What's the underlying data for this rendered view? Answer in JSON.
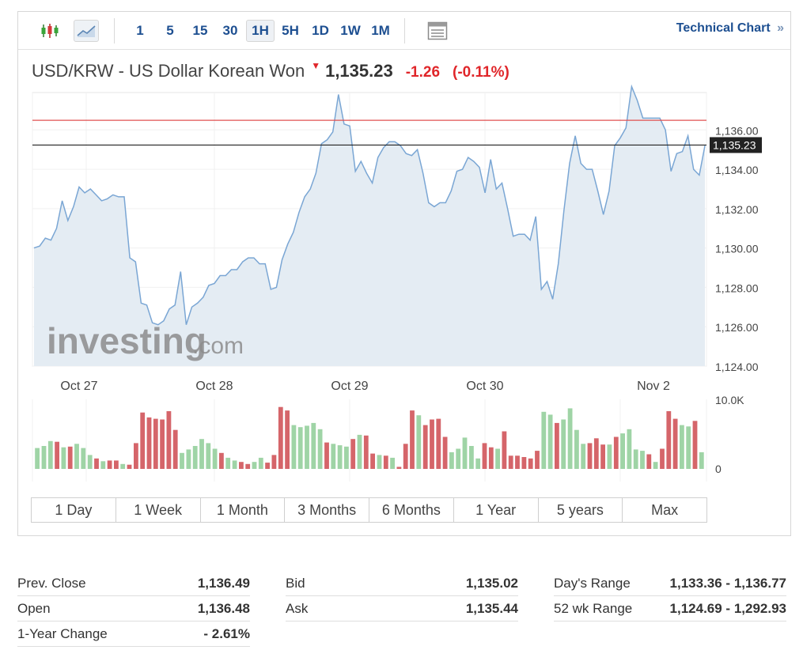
{
  "toolbar": {
    "icons": [
      "candlestick-icon",
      "area-chart-icon",
      "table-icon"
    ],
    "intervals": [
      "1",
      "5",
      "15",
      "30",
      "1H",
      "5H",
      "1D",
      "1W",
      "1M"
    ],
    "active_interval": "1H",
    "tech_link": "Technical Chart",
    "tech_link_arrow": "»"
  },
  "header": {
    "pair_name": "USD/KRW - US Dollar Korean Won",
    "direction_arrow": "▼",
    "last": "1,135.23",
    "change": "-1.26",
    "change_pct": "(-0.11%)"
  },
  "watermark": {
    "brand": "investing",
    "suffix": ".com"
  },
  "chart_data": {
    "type": "area",
    "x_tick_labels": [
      "Oct 27",
      "Oct 28",
      "Oct 29",
      "Oct 30",
      "Nov 2"
    ],
    "y_tick_labels": [
      "1,124.00",
      "1,126.00",
      "1,128.00",
      "1,130.00",
      "1,132.00",
      "1,134.00",
      "1,136.00"
    ],
    "ylim": [
      1124,
      1137.9
    ],
    "current_price": 1135.23,
    "current_price_label": "1,135.23",
    "prev_close_line": 1136.49,
    "price_series": [
      1130.0,
      1130.1,
      1130.5,
      1130.4,
      1131.0,
      1132.4,
      1131.4,
      1132.1,
      1133.1,
      1132.8,
      1133.0,
      1132.7,
      1132.4,
      1132.5,
      1132.7,
      1132.6,
      1132.6,
      1129.5,
      1129.3,
      1127.2,
      1127.1,
      1126.2,
      1126.1,
      1126.3,
      1126.9,
      1127.1,
      1128.8,
      1126.1,
      1127.0,
      1127.2,
      1127.5,
      1128.1,
      1128.2,
      1128.6,
      1128.6,
      1128.9,
      1128.9,
      1129.3,
      1129.5,
      1129.5,
      1129.2,
      1129.2,
      1127.9,
      1128.0,
      1129.4,
      1130.2,
      1130.8,
      1131.8,
      1132.6,
      1133.0,
      1133.8,
      1135.3,
      1135.5,
      1135.9,
      1137.8,
      1136.3,
      1136.2,
      1133.9,
      1134.4,
      1133.8,
      1133.3,
      1134.6,
      1135.1,
      1135.4,
      1135.4,
      1135.2,
      1134.8,
      1134.7,
      1135.0,
      1133.8,
      1132.3,
      1132.1,
      1132.3,
      1132.3,
      1132.9,
      1133.9,
      1134.0,
      1134.6,
      1134.4,
      1134.1,
      1132.8,
      1134.5,
      1133.0,
      1133.3,
      1132.0,
      1130.6,
      1130.7,
      1130.7,
      1130.4,
      1131.6,
      1127.9,
      1128.3,
      1127.4,
      1129.2,
      1131.9,
      1134.3,
      1135.7,
      1134.3,
      1134.0,
      1134.0,
      1132.9,
      1131.7,
      1132.9,
      1135.2,
      1135.6,
      1136.1,
      1138.2,
      1137.5,
      1136.6,
      1136.6,
      1136.6,
      1136.6,
      1136.0,
      1133.9,
      1134.8,
      1134.9,
      1135.7,
      1134.0,
      1133.7,
      1135.2
    ],
    "volume_axis_labels": [
      "10.0K",
      "0"
    ],
    "volume_max": 10000,
    "volume_bars": [
      {
        "v": 3000,
        "up": 1
      },
      {
        "v": 3300,
        "up": 1
      },
      {
        "v": 4000,
        "up": 1
      },
      {
        "v": 3900,
        "up": 0
      },
      {
        "v": 3100,
        "up": 1
      },
      {
        "v": 3200,
        "up": 0
      },
      {
        "v": 3600,
        "up": 1
      },
      {
        "v": 3000,
        "up": 1
      },
      {
        "v": 2000,
        "up": 1
      },
      {
        "v": 1500,
        "up": 0
      },
      {
        "v": 1100,
        "up": 1
      },
      {
        "v": 1200,
        "up": 0
      },
      {
        "v": 1200,
        "up": 0
      },
      {
        "v": 700,
        "up": 1
      },
      {
        "v": 600,
        "up": 0
      },
      {
        "v": 3700,
        "up": 0
      },
      {
        "v": 8100,
        "up": 0
      },
      {
        "v": 7400,
        "up": 0
      },
      {
        "v": 7200,
        "up": 0
      },
      {
        "v": 7100,
        "up": 0
      },
      {
        "v": 8300,
        "up": 0
      },
      {
        "v": 5600,
        "up": 0
      },
      {
        "v": 2300,
        "up": 1
      },
      {
        "v": 2800,
        "up": 1
      },
      {
        "v": 3300,
        "up": 1
      },
      {
        "v": 4300,
        "up": 1
      },
      {
        "v": 3700,
        "up": 1
      },
      {
        "v": 2900,
        "up": 1
      },
      {
        "v": 2300,
        "up": 0
      },
      {
        "v": 1600,
        "up": 1
      },
      {
        "v": 1200,
        "up": 1
      },
      {
        "v": 1000,
        "up": 0
      },
      {
        "v": 700,
        "up": 0
      },
      {
        "v": 1000,
        "up": 1
      },
      {
        "v": 1600,
        "up": 1
      },
      {
        "v": 900,
        "up": 0
      },
      {
        "v": 2000,
        "up": 0
      },
      {
        "v": 8900,
        "up": 0
      },
      {
        "v": 8400,
        "up": 0
      },
      {
        "v": 6300,
        "up": 1
      },
      {
        "v": 6000,
        "up": 1
      },
      {
        "v": 6200,
        "up": 1
      },
      {
        "v": 6600,
        "up": 1
      },
      {
        "v": 5700,
        "up": 1
      },
      {
        "v": 3800,
        "up": 0
      },
      {
        "v": 3600,
        "up": 1
      },
      {
        "v": 3400,
        "up": 1
      },
      {
        "v": 3200,
        "up": 1
      },
      {
        "v": 4300,
        "up": 0
      },
      {
        "v": 4900,
        "up": 1
      },
      {
        "v": 4800,
        "up": 0
      },
      {
        "v": 2200,
        "up": 0
      },
      {
        "v": 2000,
        "up": 1
      },
      {
        "v": 1900,
        "up": 0
      },
      {
        "v": 1600,
        "up": 1
      },
      {
        "v": 300,
        "up": 0
      },
      {
        "v": 3600,
        "up": 0
      },
      {
        "v": 8400,
        "up": 0
      },
      {
        "v": 7700,
        "up": 1
      },
      {
        "v": 6300,
        "up": 0
      },
      {
        "v": 7100,
        "up": 0
      },
      {
        "v": 7200,
        "up": 0
      },
      {
        "v": 4600,
        "up": 0
      },
      {
        "v": 2400,
        "up": 1
      },
      {
        "v": 2900,
        "up": 1
      },
      {
        "v": 4500,
        "up": 1
      },
      {
        "v": 3300,
        "up": 1
      },
      {
        "v": 1500,
        "up": 1
      },
      {
        "v": 3700,
        "up": 0
      },
      {
        "v": 3100,
        "up": 0
      },
      {
        "v": 2900,
        "up": 1
      },
      {
        "v": 5400,
        "up": 0
      },
      {
        "v": 1900,
        "up": 0
      },
      {
        "v": 1900,
        "up": 0
      },
      {
        "v": 1700,
        "up": 0
      },
      {
        "v": 1500,
        "up": 0
      },
      {
        "v": 2600,
        "up": 0
      },
      {
        "v": 8200,
        "up": 1
      },
      {
        "v": 7800,
        "up": 1
      },
      {
        "v": 6600,
        "up": 0
      },
      {
        "v": 7100,
        "up": 1
      },
      {
        "v": 8700,
        "up": 1
      },
      {
        "v": 5600,
        "up": 1
      },
      {
        "v": 3600,
        "up": 1
      },
      {
        "v": 3700,
        "up": 0
      },
      {
        "v": 4400,
        "up": 0
      },
      {
        "v": 3500,
        "up": 0
      },
      {
        "v": 3500,
        "up": 1
      },
      {
        "v": 4600,
        "up": 0
      },
      {
        "v": 5100,
        "up": 1
      },
      {
        "v": 5700,
        "up": 1
      },
      {
        "v": 2800,
        "up": 1
      },
      {
        "v": 2600,
        "up": 1
      },
      {
        "v": 2100,
        "up": 0
      },
      {
        "v": 1000,
        "up": 1
      },
      {
        "v": 2900,
        "up": 0
      },
      {
        "v": 8300,
        "up": 0
      },
      {
        "v": 7200,
        "up": 0
      },
      {
        "v": 6300,
        "up": 1
      },
      {
        "v": 6100,
        "up": 1
      },
      {
        "v": 6900,
        "up": 0
      },
      {
        "v": 2400,
        "up": 1
      }
    ],
    "up_color": "#9fd4a6",
    "down_color": "#d5656a",
    "line_color": "#7aa6d4",
    "fill_color": "#e4ecf3"
  },
  "ranges": [
    "1 Day",
    "1 Week",
    "1 Month",
    "3 Months",
    "6 Months",
    "1 Year",
    "5 years",
    "Max"
  ],
  "stats": {
    "col1": [
      {
        "label": "Prev. Close",
        "value": "1,136.49"
      },
      {
        "label": "Open",
        "value": "1,136.48"
      },
      {
        "label": "1-Year Change",
        "value": "- 2.61%"
      }
    ],
    "col2": [
      {
        "label": "Bid",
        "value": "1,135.02"
      },
      {
        "label": "Ask",
        "value": "1,135.44"
      }
    ],
    "col3": [
      {
        "label": "Day's Range",
        "value": "1,133.36 - 1,136.77"
      },
      {
        "label": "52 wk Range",
        "value": "1,124.69 - 1,292.93"
      }
    ]
  },
  "colors": {
    "accent": "#1d4f91",
    "down": "#e0262a"
  }
}
